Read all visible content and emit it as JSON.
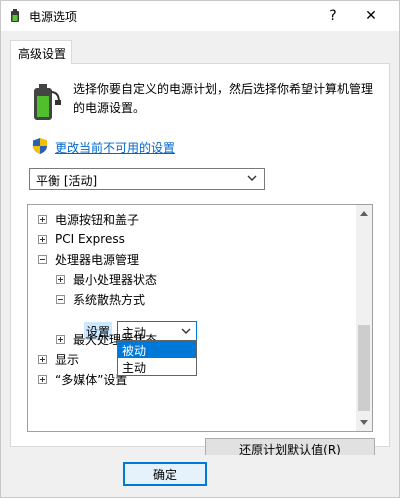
{
  "window": {
    "title": "电源选项",
    "help_glyph": "?",
    "close_glyph": "✕"
  },
  "tabs": [
    {
      "label": "高级设置"
    }
  ],
  "header": {
    "description": "选择你要自定义的电源计划，然后选择你希望计算机管理的电源设置。",
    "change_link": "更改当前不可用的设置"
  },
  "plan_select": {
    "value": "平衡 [活动]"
  },
  "tree": {
    "items": [
      {
        "label": "电源按钮和盖子",
        "state": "collapsed",
        "level": 0
      },
      {
        "label": "PCI Express",
        "state": "collapsed",
        "level": 0
      },
      {
        "label": "处理器电源管理",
        "state": "expanded",
        "level": 0
      },
      {
        "label": "最小处理器状态",
        "state": "collapsed",
        "level": 1
      },
      {
        "label": "系统散热方式",
        "state": "expanded",
        "level": 1
      },
      {
        "label": "最大处理器状态",
        "state": "collapsed",
        "level": 1
      },
      {
        "label": "显示",
        "state": "collapsed",
        "level": 0
      },
      {
        "label": "“多媒体”设置",
        "state": "collapsed",
        "level": 0
      }
    ],
    "setting_label": "设置",
    "selected_value": "主动",
    "options": [
      {
        "label": "被动",
        "highlighted": true
      },
      {
        "label": "主动",
        "highlighted": false
      }
    ]
  },
  "buttons": {
    "restore_defaults": "还原计划默认值(R)",
    "ok": "确定"
  },
  "colors": {
    "link": "#0066cc",
    "accent": "#0078d7",
    "dialog_bg": "#f0f0f0"
  },
  "icons": {
    "app": "battery-plug-icon",
    "header": "battery-power-icon",
    "shield": "uac-shield-icon"
  }
}
